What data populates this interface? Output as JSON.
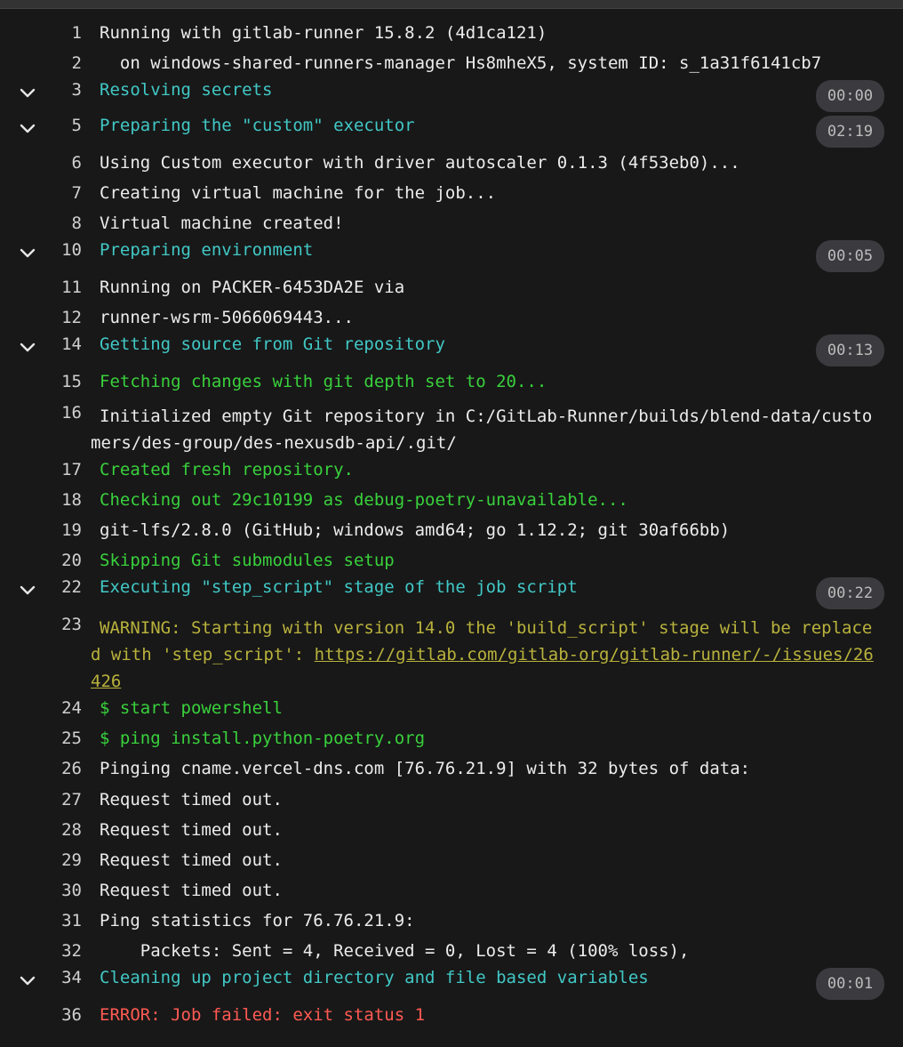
{
  "log": {
    "l1": {
      "num": "1",
      "text": "Running with gitlab-runner 15.8.2 (4d1ca121)"
    },
    "l2": {
      "num": "2",
      "text": "  on windows-shared-runners-manager Hs8mheX5, system ID: s_1a31f6141cb7"
    },
    "l3": {
      "num": "3",
      "text": "Resolving secrets",
      "time": "00:00"
    },
    "l5": {
      "num": "5",
      "text": "Preparing the \"custom\" executor",
      "time": "02:19"
    },
    "l6": {
      "num": "6",
      "text": "Using Custom executor with driver autoscaler 0.1.3 (4f53eb0)..."
    },
    "l7": {
      "num": "7",
      "text": "Creating virtual machine for the job..."
    },
    "l8": {
      "num": "8",
      "text": "Virtual machine created!"
    },
    "l10": {
      "num": "10",
      "text": "Preparing environment",
      "time": "00:05"
    },
    "l11": {
      "num": "11",
      "text": "Running on PACKER-6453DA2E via"
    },
    "l12": {
      "num": "12",
      "text": "runner-wsrm-5066069443..."
    },
    "l14": {
      "num": "14",
      "text": "Getting source from Git repository",
      "time": "00:13"
    },
    "l15": {
      "num": "15",
      "text": "Fetching changes with git depth set to 20..."
    },
    "l16": {
      "num": "16",
      "text": "Initialized empty Git repository in C:/GitLab-Runner/builds/blend-data/customers/des-group/des-nexusdb-api/.git/"
    },
    "l17": {
      "num": "17",
      "text": "Created fresh repository."
    },
    "l18": {
      "num": "18",
      "text": "Checking out 29c10199 as debug-poetry-unavailable..."
    },
    "l19": {
      "num": "19",
      "text": "git-lfs/2.8.0 (GitHub; windows amd64; go 1.12.2; git 30af66bb)"
    },
    "l20": {
      "num": "20",
      "text": "Skipping Git submodules setup"
    },
    "l22": {
      "num": "22",
      "text": "Executing \"step_script\" stage of the job script",
      "time": "00:22"
    },
    "l23": {
      "num": "23",
      "text": "WARNING: Starting with version 14.0 the 'build_script' stage will be replaced with 'step_script': ",
      "link": "https://gitlab.com/gitlab-org/gitlab-runner/-/issues/26426"
    },
    "l24": {
      "num": "24",
      "text": "$ start powershell"
    },
    "l25": {
      "num": "25",
      "text": "$ ping install.python-poetry.org"
    },
    "l26": {
      "num": "26",
      "text": "Pinging cname.vercel-dns.com [76.76.21.9] with 32 bytes of data:"
    },
    "l27": {
      "num": "27",
      "text": "Request timed out."
    },
    "l28": {
      "num": "28",
      "text": "Request timed out."
    },
    "l29": {
      "num": "29",
      "text": "Request timed out."
    },
    "l30": {
      "num": "30",
      "text": "Request timed out."
    },
    "l31": {
      "num": "31",
      "text": "Ping statistics for 76.76.21.9:"
    },
    "l32": {
      "num": "32",
      "text": "    Packets: Sent = 4, Received = 0, Lost = 4 (100% loss),"
    },
    "l34": {
      "num": "34",
      "text": "Cleaning up project directory and file based variables",
      "time": "00:01"
    },
    "l36": {
      "num": "36",
      "text": "ERROR: Job failed: exit status 1"
    }
  },
  "colors": {
    "background": "#181818",
    "section": "#41c8c6",
    "success": "#39d13c",
    "warning": "#b9b23c",
    "error": "#ff5a52",
    "badge": "#3b3b3f"
  },
  "icons": {
    "section_toggle": "chevron-down-icon"
  }
}
